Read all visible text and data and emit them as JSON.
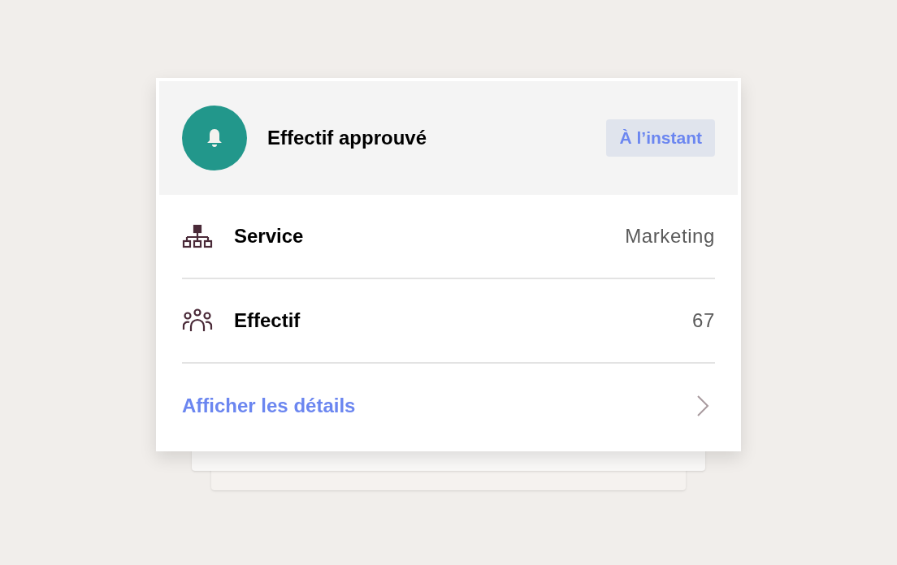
{
  "notification": {
    "title": "Effectif approuvé",
    "time": "À l’instant"
  },
  "rows": [
    {
      "kind": "department",
      "label": "Service",
      "value": "Marketing"
    },
    {
      "kind": "headcount",
      "label": "Effectif",
      "value": "67"
    }
  ],
  "link": {
    "label": "Afficher les détails"
  }
}
